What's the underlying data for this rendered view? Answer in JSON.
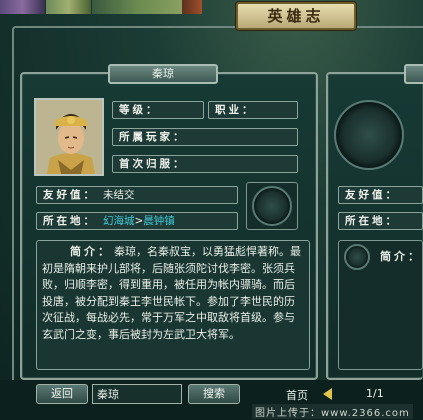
{
  "window": {
    "title": "英雄志"
  },
  "hero": {
    "name_tab": "秦琼",
    "fields": {
      "level_label": "等级：",
      "job_label": "职业：",
      "owner_label": "所属玩家：",
      "first_return_label": "首次归服：",
      "friendship_label": "友好值：",
      "friendship_value": "未结交",
      "location_label": "所在地：",
      "location_city": "幻海城",
      "location_sep": ">",
      "location_town": "晨钟镇"
    },
    "intro_label": "简介：",
    "intro_text": "秦琼，名秦叔宝，以勇猛彪悍著称。最初是隋朝来护儿部将，后随张须陀讨伐李密。张须兵败，归顺李密，得到重用，被任用为帐内骠骑。而后投唐，被分配到秦王李世民帐下。参加了李世民的历次征战，每战必先，常于万军之中取敌将首级。参与玄武门之变，事后被封为左武卫大将军。"
  },
  "right_panel": {
    "friendship_label": "友好值：",
    "location_label": "所在地：",
    "intro_label": "简介："
  },
  "bottom_bar": {
    "back_label": "返回",
    "search_value": "秦琼",
    "search_label": "搜索",
    "first_page_label": "首页",
    "page_indicator": "1/1"
  },
  "watermark": "图片上传于：www.2366.com",
  "colors": {
    "link": "#43c9d8",
    "banner": "#e8ddb0",
    "arrow": "#e3c34a"
  }
}
